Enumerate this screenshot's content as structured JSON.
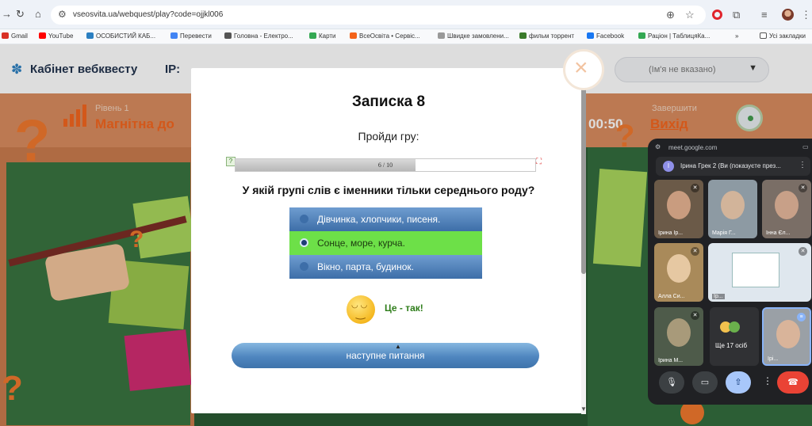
{
  "browser": {
    "url": "vseosvita.ua/webquest/play?code=ojjkl006",
    "bookmarks": [
      {
        "label": "Gmail",
        "color": "#d93025"
      },
      {
        "label": "YouTube",
        "color": "#ff0000"
      },
      {
        "label": "ОСОБИСТИЙ КАБ...",
        "color": "#2b7fc1"
      },
      {
        "label": "Перевести",
        "color": "#4285f4"
      },
      {
        "label": "Головна - Електро...",
        "color": "#555555"
      },
      {
        "label": "Карти",
        "color": "#34a853"
      },
      {
        "label": "ВсеОсвіта • Сервіс...",
        "color": "#f4631a"
      },
      {
        "label": "Швидке замовлени...",
        "color": "#999999"
      },
      {
        "label": "фильм торрент",
        "color": "#3a7a2a"
      },
      {
        "label": "Facebook",
        "color": "#1877f2"
      },
      {
        "label": "Раціон | ТаблицяКа...",
        "color": "#34a853"
      },
      {
        "label": "»",
        "color": ""
      },
      {
        "label": "Усі закладки",
        "color": "#555555"
      }
    ]
  },
  "site": {
    "title": "Кабінет вебквесту",
    "ip_label": "IP:",
    "name_placeholder": "(Ім'я не вказано)",
    "level_small": "Рівень 1",
    "level_big": "Магнітна до",
    "timer": "00:50",
    "exit_small": "Завершити",
    "exit_label": "Вихід"
  },
  "modal": {
    "title": "Записка 8",
    "subtitle": "Пройди гру:",
    "progress_text": "6 / 10",
    "progress_value": 0.6,
    "question": "У якій групі слів є іменники тільки середнього роду?",
    "answers": [
      {
        "label": "Дівчинка, хлопчики, писеня.",
        "state": "normal"
      },
      {
        "label": "Сонце, море, курча.",
        "state": "selected"
      },
      {
        "label": "Вікно, парта, будинок.",
        "state": "normal"
      }
    ],
    "feedback": "Це - так!",
    "next_button": "наступне питання"
  },
  "meet": {
    "url": "meet.google.com",
    "banner": "Ірина Грек 2 (Ви (показуєте през...",
    "participants": [
      {
        "name": "Ірина Ір..."
      },
      {
        "name": "Марія Г..."
      },
      {
        "name": "Інна Єл..."
      },
      {
        "name": "Алла Си..."
      },
      {
        "name": "Ір..."
      },
      {
        "name": "Ірина М..."
      },
      {
        "name": "Ірі..."
      }
    ],
    "more_label": "Ще 17 осіб"
  },
  "colors": {
    "accent_orange": "#f4631a",
    "answer_selected": "#6de048",
    "answer_normal": "#4f7eb8",
    "meet_end": "#ea4335"
  }
}
